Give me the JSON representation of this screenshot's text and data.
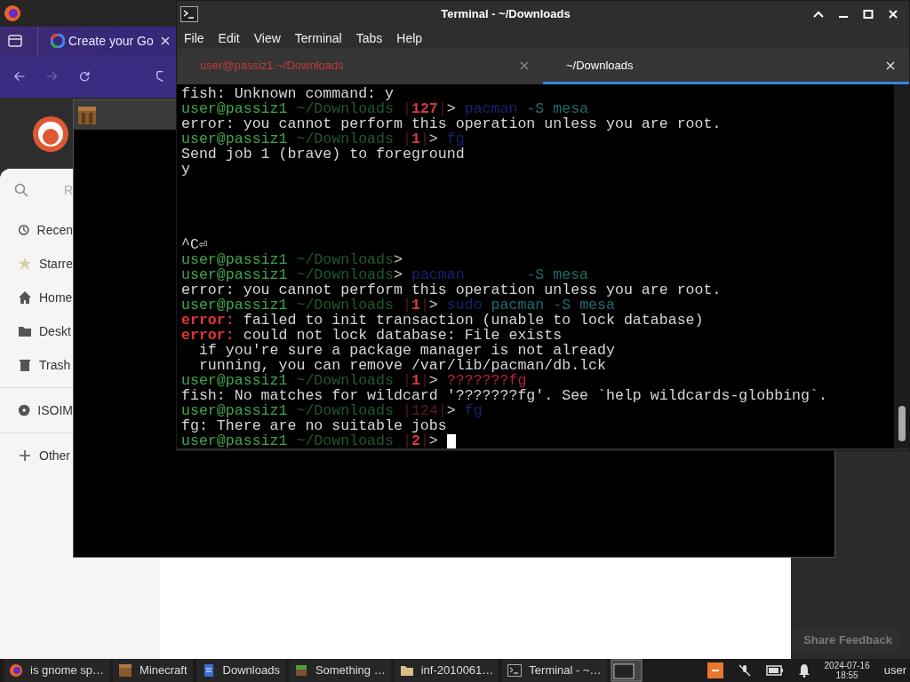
{
  "browser": {
    "tab": {
      "title": "Create your Go"
    }
  },
  "file_manager": {
    "search_hint": "R",
    "places": [
      {
        "label": "Recen",
        "kind": "recent"
      },
      {
        "label": "Starre",
        "kind": "starred"
      },
      {
        "label": "Home",
        "kind": "home"
      },
      {
        "label": "Deskt",
        "kind": "folder"
      },
      {
        "label": "Trash",
        "kind": "trash",
        "divider_after": true
      },
      {
        "label": "ISOIM",
        "kind": "disc",
        "divider_after": true
      },
      {
        "label": "Other",
        "kind": "plus"
      }
    ]
  },
  "terminal": {
    "title": "Terminal - ~/Downloads",
    "menu": [
      "File",
      "Edit",
      "View",
      "Terminal",
      "Tabs",
      "Help"
    ],
    "tabs": [
      {
        "label": "user@passiz1:~/Downloads",
        "selected": false
      },
      {
        "label": "~/Downloads",
        "selected": true
      }
    ],
    "lines": [
      {
        "segments": [
          {
            "kind": "out",
            "text": "fish: Unknown command: y"
          }
        ]
      },
      {
        "segments": [
          {
            "kind": "user",
            "text": "user@passiz1"
          },
          {
            "kind": "path",
            "text": " ~/Downloads"
          },
          {
            "kind": "sep",
            "text": " |"
          },
          {
            "kind": "status",
            "text": "127"
          },
          {
            "kind": "sep",
            "text": "|"
          },
          {
            "kind": "out",
            "text": "> "
          },
          {
            "kind": "dim",
            "text": "pacman"
          },
          {
            "kind": "arg",
            "text": " -S mesa"
          }
        ]
      },
      {
        "segments": [
          {
            "kind": "out",
            "text": "error: you cannot perform this operation unless you are root."
          }
        ]
      },
      {
        "segments": [
          {
            "kind": "user",
            "text": "user@passiz1"
          },
          {
            "kind": "path",
            "text": " ~/Downloads"
          },
          {
            "kind": "sep",
            "text": " |"
          },
          {
            "kind": "status",
            "text": "1"
          },
          {
            "kind": "sep",
            "text": "|"
          },
          {
            "kind": "out",
            "text": "> "
          },
          {
            "kind": "dim",
            "text": "fg"
          }
        ]
      },
      {
        "segments": [
          {
            "kind": "out",
            "text": "Send job 1 (brave) to foreground"
          }
        ]
      },
      {
        "segments": [
          {
            "kind": "out",
            "text": "y"
          }
        ]
      },
      {
        "blank": true
      },
      {
        "blank": true
      },
      {
        "blank": true
      },
      {
        "blank": true
      },
      {
        "segments": [
          {
            "kind": "out",
            "text": "^C⏎"
          }
        ]
      },
      {
        "segments": [
          {
            "kind": "user",
            "text": "user@passiz1"
          },
          {
            "kind": "path",
            "text": " ~/Downloads"
          },
          {
            "kind": "out",
            "text": ">"
          }
        ]
      },
      {
        "segments": [
          {
            "kind": "user",
            "text": "user@passiz1"
          },
          {
            "kind": "path",
            "text": " ~/Downloads"
          },
          {
            "kind": "out",
            "text": "> "
          },
          {
            "kind": "dim",
            "text": "pacman"
          },
          {
            "kind": "arg",
            "text": "       -S mesa"
          }
        ]
      },
      {
        "segments": [
          {
            "kind": "out",
            "text": "error: you cannot perform this operation unless you are root."
          }
        ]
      },
      {
        "segments": [
          {
            "kind": "user",
            "text": "user@passiz1"
          },
          {
            "kind": "path",
            "text": " ~/Downloads"
          },
          {
            "kind": "sep",
            "text": " |"
          },
          {
            "kind": "status",
            "text": "1"
          },
          {
            "kind": "sep",
            "text": "|"
          },
          {
            "kind": "out",
            "text": "> "
          },
          {
            "kind": "dim",
            "text": "sudo"
          },
          {
            "kind": "arg",
            "text": " pacman -S mesa"
          }
        ]
      },
      {
        "segments": [
          {
            "kind": "err",
            "text": "error:"
          },
          {
            "kind": "out",
            "text": " failed to init transaction (unable to lock database)"
          }
        ]
      },
      {
        "segments": [
          {
            "kind": "err",
            "text": "error:"
          },
          {
            "kind": "out",
            "text": " could not lock database: File exists"
          }
        ]
      },
      {
        "segments": [
          {
            "kind": "out",
            "text": "  if you're sure a package manager is not already"
          }
        ]
      },
      {
        "segments": [
          {
            "kind": "out",
            "text": "  running, you can remove /var/lib/pacman/db.lck"
          }
        ]
      },
      {
        "segments": [
          {
            "kind": "user",
            "text": "user@passiz1"
          },
          {
            "kind": "path",
            "text": " ~/Downloads"
          },
          {
            "kind": "sep",
            "text": " |"
          },
          {
            "kind": "status",
            "text": "1"
          },
          {
            "kind": "sep",
            "text": "|"
          },
          {
            "kind": "out",
            "text": "> "
          },
          {
            "kind": "bad",
            "text": "???????fg"
          }
        ]
      },
      {
        "segments": [
          {
            "kind": "out",
            "text": "fish: No matches for wildcard '???????fg'. See `help wildcards-globbing`."
          }
        ]
      },
      {
        "segments": [
          {
            "kind": "user",
            "text": "user@passiz1"
          },
          {
            "kind": "path",
            "text": " ~/Downloads"
          },
          {
            "kind": "sep",
            "text": " |"
          },
          {
            "kind": "sep",
            "text": "124"
          },
          {
            "kind": "sep",
            "text": "|"
          },
          {
            "kind": "out",
            "text": "> "
          },
          {
            "kind": "dim",
            "text": "fg"
          }
        ]
      },
      {
        "segments": [
          {
            "kind": "out",
            "text": "fg: There are no suitable jobs"
          }
        ]
      },
      {
        "segments": [
          {
            "kind": "user",
            "text": "user@passiz1"
          },
          {
            "kind": "path",
            "text": " ~/Downloads"
          },
          {
            "kind": "sep",
            "text": " |"
          },
          {
            "kind": "status",
            "text": "2"
          },
          {
            "kind": "sep",
            "text": "|"
          },
          {
            "kind": "out",
            "text": "> "
          }
        ],
        "cursor": true
      }
    ]
  },
  "share_feedback": "Share Feedback",
  "taskbar": {
    "tasks": [
      {
        "label": "is gnome sp…",
        "kind": "browser"
      },
      {
        "label": "Minecraft",
        "kind": "crafting"
      },
      {
        "label": "Downloads",
        "kind": "document"
      },
      {
        "label": "Something …",
        "kind": "grass"
      },
      {
        "label": "inf-2010061…",
        "kind": "folder"
      },
      {
        "label": "Terminal - ~…",
        "kind": "terminal"
      }
    ],
    "date": "2024-07-16",
    "time": "18:55",
    "user": "user"
  }
}
